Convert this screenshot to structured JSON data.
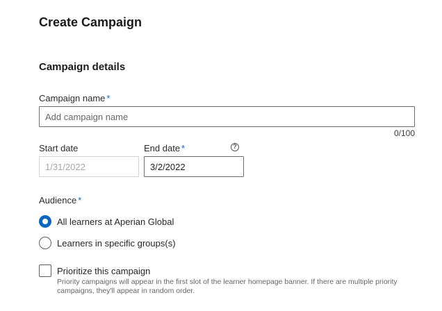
{
  "page": {
    "title": "Create Campaign"
  },
  "section": {
    "title": "Campaign details"
  },
  "required_mark": "*",
  "campaign_name": {
    "label": "Campaign name",
    "placeholder": "Add campaign name",
    "value": "",
    "counter": "0/100"
  },
  "start_date": {
    "label": "Start date",
    "value": "1/31/2022"
  },
  "end_date": {
    "label": "End date",
    "value": "3/2/2022",
    "help_icon": "question-circle-icon"
  },
  "audience": {
    "label": "Audience",
    "options": [
      {
        "label": "All learners at Aperian Global",
        "selected": true
      },
      {
        "label": "Learners in specific groups(s)",
        "selected": false
      }
    ]
  },
  "priority": {
    "label": "Prioritize this campaign",
    "checked": false,
    "description": "Priority campaigns will appear in the first slot of the learner homepage banner. If there are multiple priority campaigns, they'll appear in random order."
  },
  "colors": {
    "accent": "#0a66c2",
    "text": "#1f1f1f",
    "muted": "#666666",
    "border": "#6f6f6f"
  }
}
